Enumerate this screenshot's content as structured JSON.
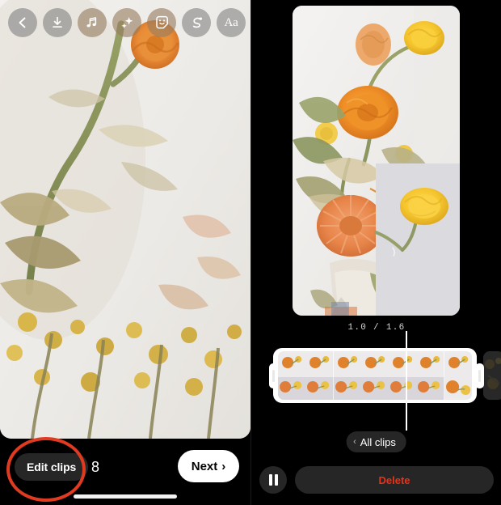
{
  "left_panel": {
    "toolbar": {
      "items": [
        {
          "name": "back-button",
          "icon": "chevron-left-icon",
          "label": ""
        },
        {
          "name": "download-button",
          "icon": "download-icon",
          "label": ""
        },
        {
          "name": "music-button",
          "icon": "music-note-icon",
          "label": ""
        },
        {
          "name": "effects-button",
          "icon": "sparkles-icon",
          "label": ""
        },
        {
          "name": "sticker-button",
          "icon": "sticker-smiley-icon",
          "label": ""
        },
        {
          "name": "draw-button",
          "icon": "squiggle-draw-icon",
          "label": ""
        },
        {
          "name": "text-button",
          "icon": "text-aa-icon",
          "label": "Aa"
        }
      ]
    },
    "bottom_bar": {
      "edit_clips_label": "Edit clips",
      "clip_count": "8",
      "next_label": "Next",
      "next_chevron": "›"
    },
    "annotation": {
      "shape": "circle",
      "color": "#e03a21",
      "targets": "edit-clips-button"
    }
  },
  "right_panel": {
    "time_readout": "1.0  /  1.6",
    "current_time": "1.0",
    "total_time": "1.6",
    "frame_count": 7,
    "all_clips_label": "All clips",
    "all_clips_chevron": "‹",
    "delete_label": "Delete",
    "pause_icon": "pause-icon",
    "colors": {
      "delete_text": "#e5331a",
      "pill_background": "#262626",
      "panel_background": "#000000",
      "handle": "#ffffff"
    }
  }
}
